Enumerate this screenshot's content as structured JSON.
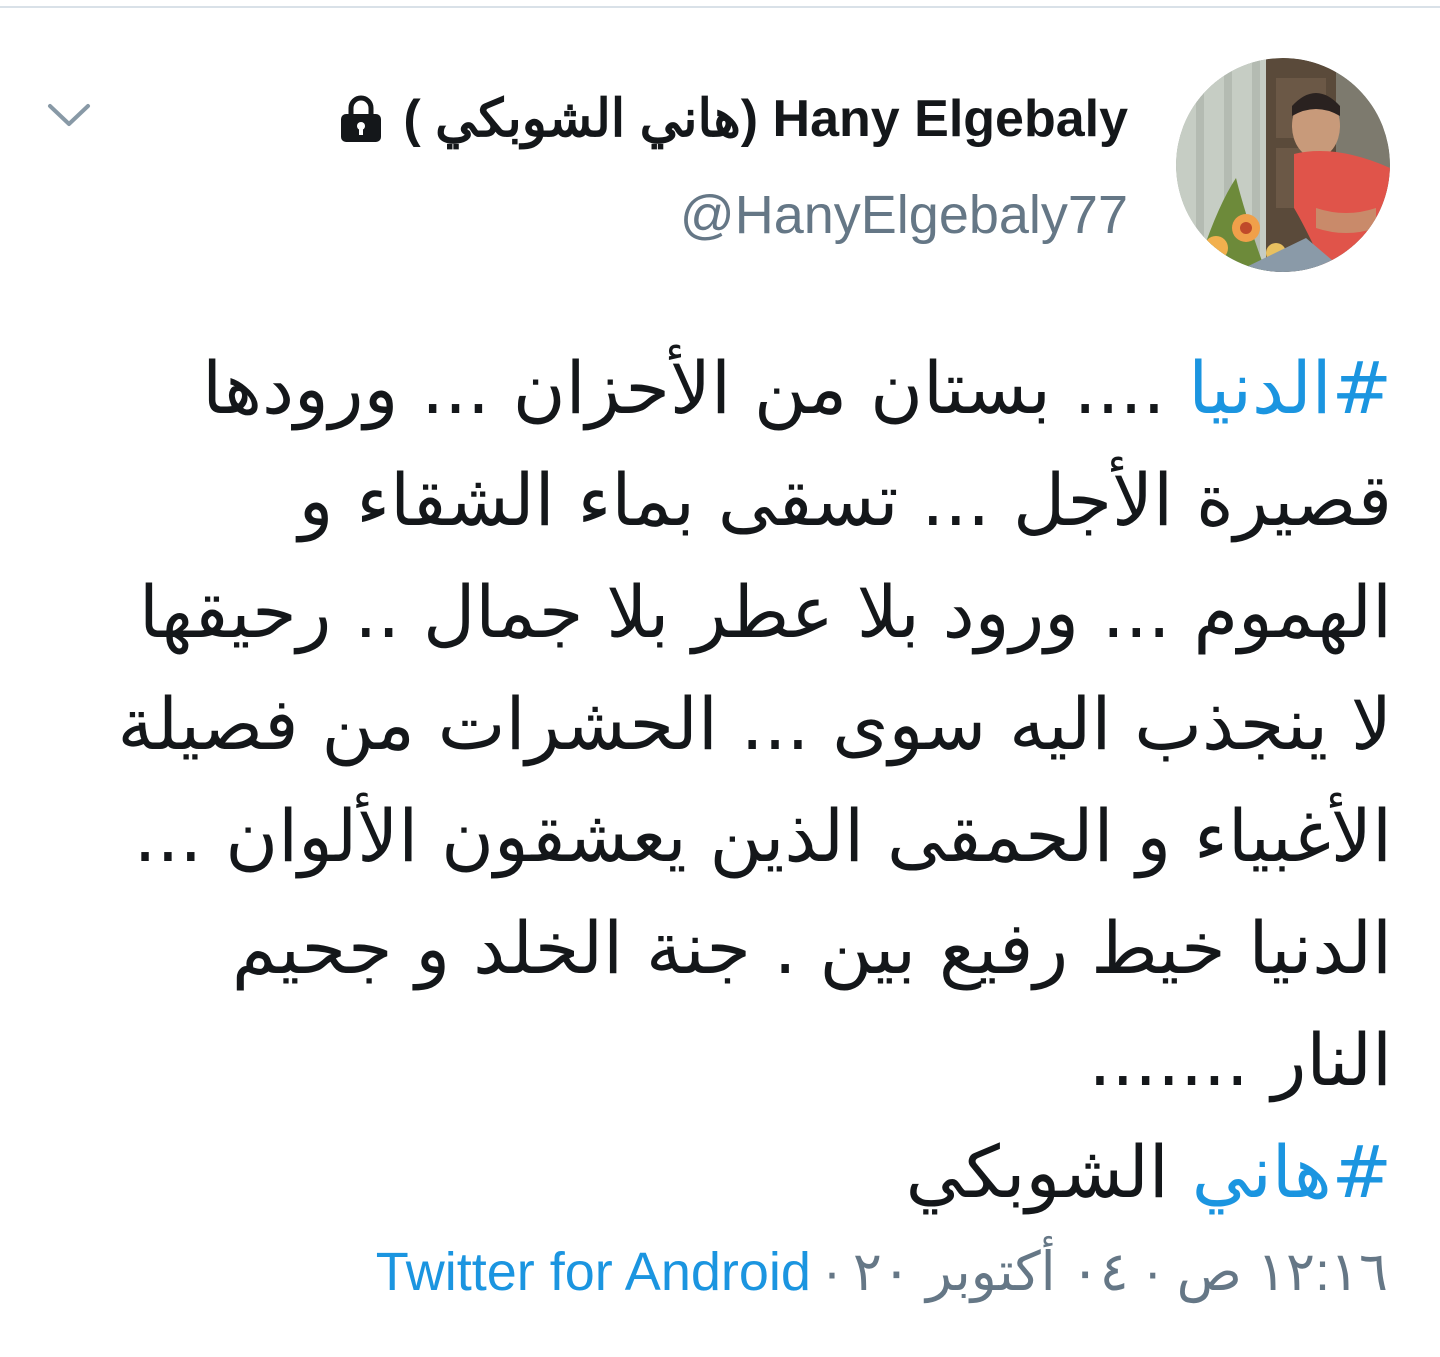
{
  "header": {
    "display_name": "( هاني الشوبكي) Hany Elgebaly",
    "handle": "@HanyElgebaly77"
  },
  "icons": {
    "chevron": "chevron-down-icon",
    "lock": "lock-icon",
    "avatar": "profile-photo"
  },
  "tweet": {
    "line1_hashtag": "#الدنيا",
    "line1_text": "  .... بستان من الأحزان ... ورودها",
    "line2": "قصيرة الأجل ... تسقى بماء الشقاء و",
    "line3": "الهموم  ... ورود بلا عطر بلا جمال .. رحيقها",
    "line4": "لا ينجذب اليه سوى ... الحشرات من فصيلة",
    "line5": "الأغبياء و الحمقى الذين يعشقون الألوان ...",
    "line6": "الدنيا  خيط  رفيع بين . جنة الخلد و جحيم",
    "line7": "النار .......",
    "line8_hashtag": "#هاني",
    "line8_text": " الشوبكي"
  },
  "meta": {
    "time_date": "١٢:١٦ ص · ٠٤ أكتوبر ٢٠",
    "separator": "·",
    "source": "Twitter for Android"
  },
  "colors": {
    "link": "#1b95e0",
    "secondary": "#657786",
    "text": "#14171a"
  }
}
